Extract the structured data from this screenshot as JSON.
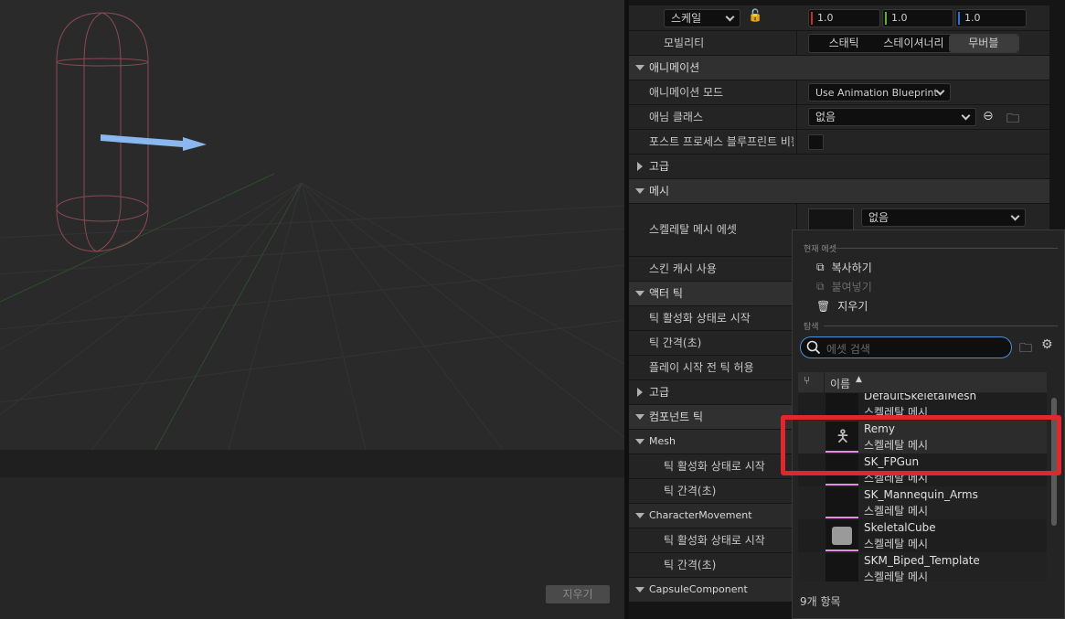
{
  "details": {
    "scale": {
      "label": "스케일",
      "x": "1.0",
      "y": "1.0",
      "z": "1.0"
    },
    "mobility": {
      "label": "모빌리티",
      "options": [
        "스태틱",
        "스테이셔너리",
        "무버블"
      ],
      "selected": "무버블"
    },
    "anim_category": "애니메이션",
    "anim_mode_label": "애니메이션 모드",
    "anim_mode_value": "Use Animation Blueprint",
    "anim_class_label": "애님 클래스",
    "anim_class_value": "없음",
    "post_process_label": "포스트 프로세스 블루프린트 비활...",
    "advanced_label": "고급",
    "mesh_category": "메시",
    "skeletal_mesh_asset_label": "스켈레탈 메시 에셋",
    "skeletal_mesh_asset_value": "없음",
    "skin_cache_label": "스킨 캐시 사용",
    "actor_tick_category": "액터 틱",
    "tick_start_enabled": "틱 활성화 상태로 시작",
    "tick_interval": "틱 간격(초)",
    "tick_before_play": "플레이 시작 전 틱 허용",
    "advanced2_label": "고급",
    "component_tick_category": "컴포넌트 틱",
    "mesh_sub": "Mesh",
    "mesh_tick_start": "틱 활성화 상태로 시작",
    "mesh_tick_interval": "틱 간격(초)",
    "charmove_sub": "CharacterMovement",
    "charmove_tick_start": "틱 활성화 상태로 시작",
    "charmove_tick_interval": "틱 간격(초)",
    "capsule_sub": "CapsuleComponent"
  },
  "viewport": {
    "clear_button": "지우기"
  },
  "popup": {
    "current_asset_header": "현재 에셋",
    "copy": "복사하기",
    "paste": "붙여넣기",
    "clear": "지우기",
    "browse_header": "탐색",
    "search_placeholder": "에셋 검색",
    "column_name": "이름",
    "assets": [
      {
        "name": "DefaultSkeletalMesh",
        "type": "스켈레탈 메시"
      },
      {
        "name": "Remy",
        "type": "스켈레탈 메시"
      },
      {
        "name": "SK_FPGun",
        "type": "스켈레탈 메시"
      },
      {
        "name": "SK_Mannequin_Arms",
        "type": "스켈레탈 메시"
      },
      {
        "name": "SkeletalCube",
        "type": "스켈레탈 메시"
      },
      {
        "name": "SKM_Biped_Template",
        "type": "스켈레탈 메시"
      }
    ],
    "item_count": "9개 항목"
  },
  "colors": {
    "highlight": "#e0282c",
    "search_focus": "#4a90d9",
    "skeletal_mesh_accent": "#e08ee0"
  }
}
